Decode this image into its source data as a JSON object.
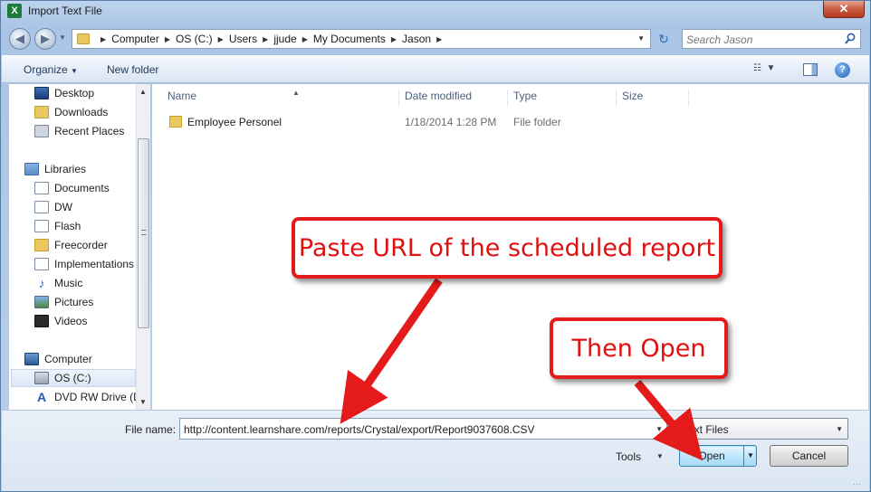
{
  "window": {
    "title": "Import Text File",
    "app_icon_letter": "X",
    "close_glyph": "✕"
  },
  "address_bar": {
    "crumbs": [
      "Computer",
      "OS (C:)",
      "Users",
      "jjude",
      "My Documents",
      "Jason"
    ],
    "search_placeholder": "Search Jason"
  },
  "toolbar": {
    "organize_label": "Organize",
    "new_folder_label": "New folder",
    "help_label": "?"
  },
  "nav_pane": {
    "items": [
      {
        "label": "Desktop",
        "icon": "desktop-icon"
      },
      {
        "label": "Downloads",
        "icon": "folder-icon"
      },
      {
        "label": "Recent Places",
        "icon": "recent-places-icon"
      },
      {
        "label": "Libraries",
        "icon": "libraries-icon"
      },
      {
        "label": "Documents",
        "icon": "documents-icon"
      },
      {
        "label": "DW",
        "icon": "document-icon"
      },
      {
        "label": "Flash",
        "icon": "document-icon"
      },
      {
        "label": "Freecorder",
        "icon": "folder-icon"
      },
      {
        "label": "Implementations",
        "icon": "document-icon"
      },
      {
        "label": "Music",
        "icon": "music-icon"
      },
      {
        "label": "Pictures",
        "icon": "pictures-icon"
      },
      {
        "label": "Videos",
        "icon": "videos-icon"
      },
      {
        "label": "Computer",
        "icon": "computer-icon"
      },
      {
        "label": "OS (C:)",
        "icon": "drive-icon"
      },
      {
        "label": "DVD RW Drive (D",
        "icon": "dvd-icon"
      }
    ]
  },
  "file_list": {
    "columns": [
      "Name",
      "Date modified",
      "Type",
      "Size"
    ],
    "rows": [
      {
        "name": "Employee Personel",
        "date_modified": "1/18/2014 1:28 PM",
        "type": "File folder",
        "size": ""
      }
    ]
  },
  "bottom": {
    "file_name_label": "File name:",
    "file_name_value": "http://content.learnshare.com/reports/Crystal/export/Report9037608.CSV",
    "file_type_value": "Text Files",
    "tools_label": "Tools",
    "open_label": "Open",
    "cancel_label": "Cancel"
  },
  "annotations": {
    "paste_callout": "Paste URL of the scheduled report",
    "open_callout": "Then Open",
    "color": "#e51b1b"
  }
}
